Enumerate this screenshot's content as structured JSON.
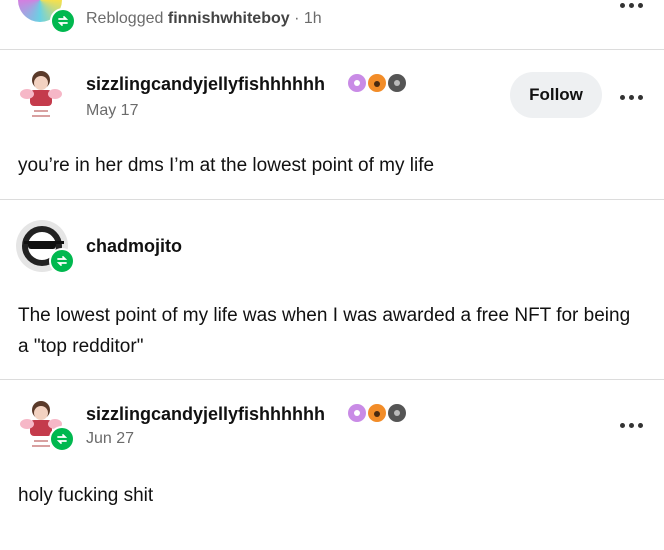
{
  "top_post": {
    "reblogged_prefix": "Reblogged",
    "reblogged_from": "finnishwhiteboy",
    "time": "1h"
  },
  "posts": [
    {
      "username": "sizzlingcandyjellyfishhhhhh",
      "date": "May 17",
      "follow_label": "Follow",
      "text": "you’re in her dms I’m at the lowest point of my life"
    },
    {
      "username": "chadmojito",
      "text": "The lowest point of my life was when I was awarded a free NFT for being a \"top redditor\""
    },
    {
      "username": "sizzlingcandyjellyfishhhhhh",
      "date": "Jun 27",
      "text": "holy fucking shit"
    }
  ],
  "icons": {
    "reblog": "reblog-icon",
    "more": "more-options-icon",
    "badges": [
      "purple-badge-icon",
      "orange-paw-badge-icon",
      "grey-badge-icon"
    ]
  },
  "colors": {
    "reblog_green": "#00b84f",
    "meta_grey": "#6b6b6b",
    "follow_bg": "#eef0f2"
  }
}
